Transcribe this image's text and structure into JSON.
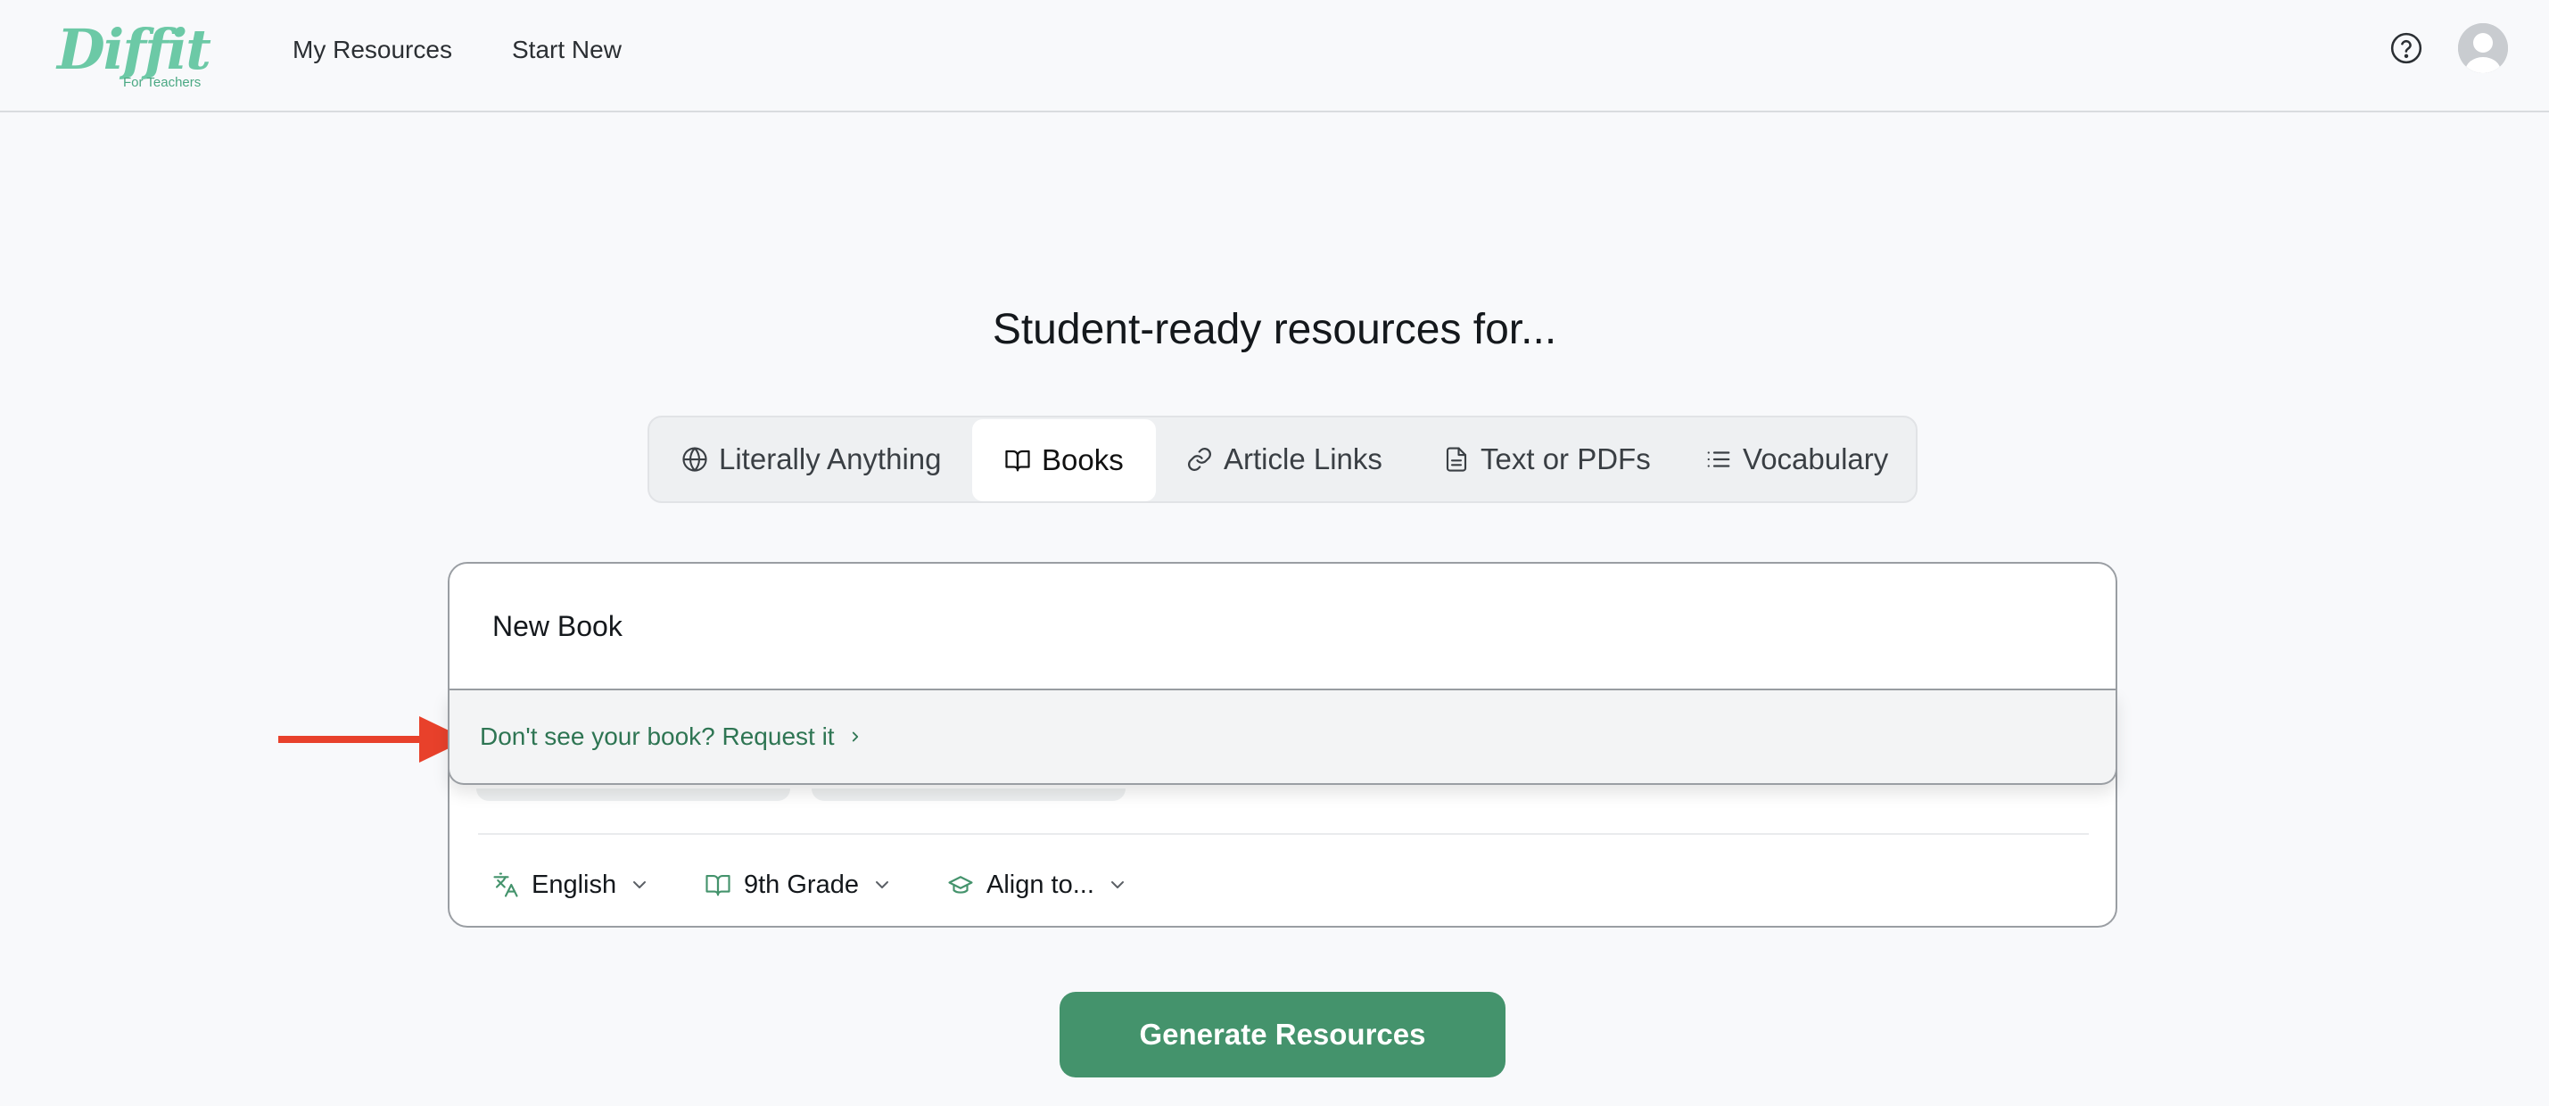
{
  "header": {
    "logo_text": "Diffit",
    "logo_subtitle": "For Teachers",
    "nav": [
      {
        "label": "My Resources"
      },
      {
        "label": "Start New"
      }
    ],
    "help_icon": "question-circle-icon",
    "avatar_icon": "user-avatar-icon"
  },
  "main": {
    "heading": "Student-ready resources for...",
    "tabs": [
      {
        "label": "Literally Anything",
        "icon": "globe-icon",
        "active": false
      },
      {
        "label": "Books",
        "icon": "book-open-icon",
        "active": true
      },
      {
        "label": "Article Links",
        "icon": "link-icon",
        "active": false
      },
      {
        "label": "Text or PDFs",
        "icon": "file-text-icon",
        "active": false
      },
      {
        "label": "Vocabulary",
        "icon": "list-icon",
        "active": false
      }
    ],
    "book_input": {
      "value": "New Book"
    },
    "dropdown": {
      "request_label": "Don't see your book? Request it",
      "icon": "chevron-right-icon"
    },
    "options": {
      "language": {
        "value": "English",
        "icon": "translate-icon"
      },
      "grade": {
        "value": "9th Grade",
        "icon": "book-open-icon"
      },
      "align": {
        "value": "Align to...",
        "icon": "graduation-cap-icon"
      }
    },
    "generate_label": "Generate Resources"
  },
  "colors": {
    "brand": "#6cc9a6",
    "primary_button": "#44936c",
    "link": "#2e7553",
    "annotation_arrow": "#e8412b"
  }
}
